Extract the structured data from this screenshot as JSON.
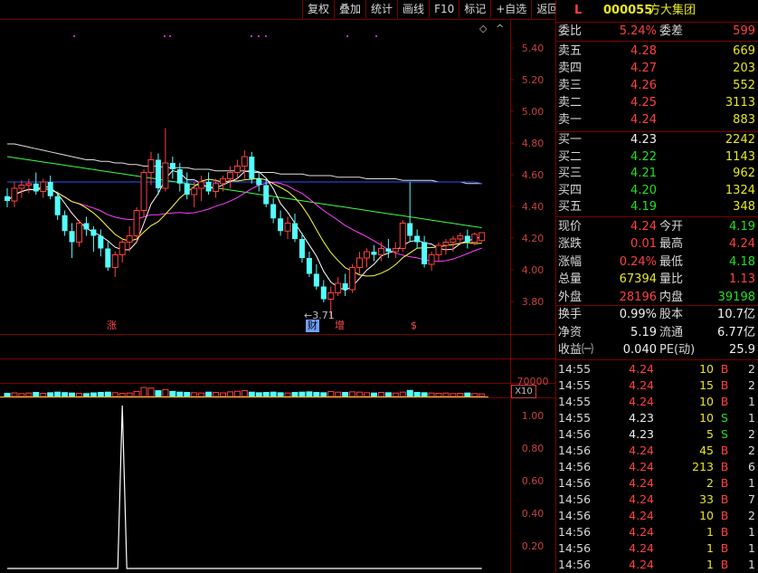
{
  "toolbar": [
    "复权",
    "叠加",
    "统计",
    "画线",
    "F10",
    "标记",
    "+自选",
    "返回"
  ],
  "stock": {
    "flag": "L",
    "code": "000055",
    "name": "方大集团"
  },
  "price_axis": [
    "5.40",
    "5.20",
    "5.00",
    "4.80",
    "4.60",
    "4.40",
    "4.20",
    "4.00",
    "3.80"
  ],
  "volume_axis": {
    "max_label": "70000",
    "scale_label": "X10"
  },
  "indicator_axis": [
    "1.00",
    "0.80",
    "0.60",
    "0.40",
    "0.20"
  ],
  "events": [
    {
      "label": "涨",
      "style": "red"
    },
    {
      "label": "财",
      "style": "blue"
    },
    {
      "label": "增",
      "style": "red"
    },
    {
      "label": "$",
      "style": "red"
    }
  ],
  "min_marker": "←3.71",
  "glyphs": {
    "diamond": "◇",
    "caret": "^"
  },
  "colors": {
    "up": "#ff4040",
    "down": "#54ffff",
    "ma5": "#ffffff",
    "ma10": "#ffff40",
    "ma20": "#ff40ff",
    "ma60": "#40ff40",
    "ma_long": "#e0e0e0",
    "ma_blue": "#3050ff",
    "frame": "#7a0000"
  },
  "order_book": {
    "webi": {
      "label": "委比",
      "value": "5.24%",
      "label2": "委差",
      "value2": "599"
    },
    "asks": [
      {
        "label": "卖五",
        "price": "4.28",
        "vol": "669"
      },
      {
        "label": "卖四",
        "price": "4.27",
        "vol": "203"
      },
      {
        "label": "卖三",
        "price": "4.26",
        "vol": "552"
      },
      {
        "label": "卖二",
        "price": "4.25",
        "vol": "3113"
      },
      {
        "label": "卖一",
        "price": "4.24",
        "vol": "883"
      }
    ],
    "bids": [
      {
        "label": "买一",
        "price": "4.23",
        "vol": "2242"
      },
      {
        "label": "买二",
        "price": "4.22",
        "vol": "1143"
      },
      {
        "label": "买三",
        "price": "4.21",
        "vol": "962"
      },
      {
        "label": "买四",
        "price": "4.20",
        "vol": "1324"
      },
      {
        "label": "买五",
        "price": "4.19",
        "vol": "348"
      }
    ]
  },
  "quote": [
    {
      "l1": "现价",
      "v1": "4.24",
      "l2": "今开",
      "v2": "4.19"
    },
    {
      "l1": "涨跌",
      "v1": "0.01",
      "l2": "最高",
      "v2": "4.24"
    },
    {
      "l1": "涨幅",
      "v1": "0.24%",
      "l2": "最低",
      "v2": "4.18"
    },
    {
      "l1": "总量",
      "v1": "67394",
      "l2": "量比",
      "v2": "1.13"
    },
    {
      "l1": "外盘",
      "v1": "28196",
      "l2": "内盘",
      "v2": "39198"
    }
  ],
  "fundamentals": [
    {
      "l1": "换手",
      "v1": "0.99%",
      "l2": "股本",
      "v2": "10.7亿"
    },
    {
      "l1": "净资",
      "v1": "5.19",
      "l2": "流通",
      "v2": "6.77亿"
    },
    {
      "l1": "收益㈠",
      "v1": "0.040",
      "l2": "PE(动)",
      "v2": "25.9"
    }
  ],
  "ticks": [
    {
      "time": "14:55",
      "price": "4.24",
      "vol": "10",
      "side": "B",
      "n": "2"
    },
    {
      "time": "14:55",
      "price": "4.24",
      "vol": "15",
      "side": "B",
      "n": "2"
    },
    {
      "time": "14:55",
      "price": "4.24",
      "vol": "10",
      "side": "B",
      "n": "1"
    },
    {
      "time": "14:55",
      "price": "4.23",
      "vol": "10",
      "side": "S",
      "n": "1"
    },
    {
      "time": "14:56",
      "price": "4.23",
      "vol": "5",
      "side": "S",
      "n": "2"
    },
    {
      "time": "14:56",
      "price": "4.24",
      "vol": "45",
      "side": "B",
      "n": "2"
    },
    {
      "time": "14:56",
      "price": "4.24",
      "vol": "213",
      "side": "B",
      "n": "6"
    },
    {
      "time": "14:56",
      "price": "4.24",
      "vol": "2",
      "side": "B",
      "n": "1"
    },
    {
      "time": "14:56",
      "price": "4.24",
      "vol": "33",
      "side": "B",
      "n": "7"
    },
    {
      "time": "14:56",
      "price": "4.24",
      "vol": "10",
      "side": "B",
      "n": "2"
    },
    {
      "time": "14:56",
      "price": "4.24",
      "vol": "1",
      "side": "B",
      "n": "1"
    },
    {
      "time": "14:56",
      "price": "4.24",
      "vol": "1",
      "side": "B",
      "n": "1"
    },
    {
      "time": "14:56",
      "price": "4.24",
      "vol": "1",
      "side": "B",
      "n": "1"
    }
  ],
  "chart_data": {
    "type": "candlestick",
    "y_range": [
      3.7,
      5.5
    ],
    "candles": [
      [
        4.47,
        4.52,
        4.4,
        4.44
      ],
      [
        4.44,
        4.56,
        4.4,
        4.52
      ],
      [
        4.52,
        4.57,
        4.46,
        4.54
      ],
      [
        4.54,
        4.58,
        4.49,
        4.55
      ],
      [
        4.55,
        4.62,
        4.48,
        4.5
      ],
      [
        4.5,
        4.58,
        4.46,
        4.56
      ],
      [
        4.56,
        4.6,
        4.45,
        4.47
      ],
      [
        4.47,
        4.5,
        4.32,
        4.35
      ],
      [
        4.35,
        4.38,
        4.22,
        4.25
      ],
      [
        4.25,
        4.3,
        4.08,
        4.18
      ],
      [
        4.18,
        4.32,
        4.15,
        4.3
      ],
      [
        4.3,
        4.34,
        4.22,
        4.26
      ],
      [
        4.26,
        4.28,
        4.12,
        4.22
      ],
      [
        4.22,
        4.26,
        4.09,
        4.14
      ],
      [
        4.14,
        4.18,
        4.0,
        4.02
      ],
      [
        4.02,
        4.12,
        3.96,
        4.1
      ],
      [
        4.1,
        4.2,
        4.05,
        4.18
      ],
      [
        4.18,
        4.28,
        4.12,
        4.22
      ],
      [
        4.22,
        4.4,
        4.18,
        4.38
      ],
      [
        4.38,
        4.64,
        4.34,
        4.62
      ],
      [
        4.62,
        4.75,
        4.54,
        4.7
      ],
      [
        4.7,
        4.74,
        4.48,
        4.52
      ],
      [
        4.52,
        4.9,
        4.5,
        4.68
      ],
      [
        4.68,
        4.72,
        4.58,
        4.64
      ],
      [
        4.64,
        4.68,
        4.5,
        4.55
      ],
      [
        4.55,
        4.62,
        4.45,
        4.48
      ],
      [
        4.48,
        4.56,
        4.4,
        4.52
      ],
      [
        4.52,
        4.6,
        4.44,
        4.56
      ],
      [
        4.56,
        4.62,
        4.48,
        4.5
      ],
      [
        4.5,
        4.58,
        4.46,
        4.55
      ],
      [
        4.55,
        4.6,
        4.5,
        4.58
      ],
      [
        4.58,
        4.66,
        4.52,
        4.62
      ],
      [
        4.62,
        4.7,
        4.58,
        4.66
      ],
      [
        4.66,
        4.76,
        4.58,
        4.72
      ],
      [
        4.72,
        4.75,
        4.55,
        4.58
      ],
      [
        4.58,
        4.62,
        4.5,
        4.54
      ],
      [
        4.54,
        4.58,
        4.4,
        4.42
      ],
      [
        4.42,
        4.46,
        4.3,
        4.33
      ],
      [
        4.33,
        4.38,
        4.22,
        4.25
      ],
      [
        4.25,
        4.34,
        4.2,
        4.3
      ],
      [
        4.3,
        4.36,
        4.18,
        4.2
      ],
      [
        4.2,
        4.24,
        4.05,
        4.08
      ],
      [
        4.08,
        4.12,
        3.96,
        3.98
      ],
      [
        3.98,
        4.04,
        3.88,
        3.9
      ],
      [
        3.9,
        3.94,
        3.8,
        3.82
      ],
      [
        3.82,
        3.9,
        3.71,
        3.86
      ],
      [
        3.86,
        3.96,
        3.84,
        3.92
      ],
      [
        3.92,
        3.98,
        3.84,
        3.88
      ],
      [
        3.88,
        4.04,
        3.86,
        4.02
      ],
      [
        4.02,
        4.12,
        3.98,
        4.08
      ],
      [
        4.08,
        4.14,
        4.02,
        4.12
      ],
      [
        4.12,
        4.16,
        4.06,
        4.1
      ],
      [
        4.1,
        4.18,
        4.06,
        4.14
      ],
      [
        4.14,
        4.2,
        4.08,
        4.12
      ],
      [
        4.12,
        4.18,
        4.08,
        4.14
      ],
      [
        4.14,
        4.32,
        4.12,
        4.3
      ],
      [
        4.3,
        4.56,
        4.18,
        4.22
      ],
      [
        4.22,
        4.26,
        4.14,
        4.18
      ],
      [
        4.18,
        4.22,
        4.02,
        4.04
      ],
      [
        4.04,
        4.12,
        4.0,
        4.1
      ],
      [
        4.1,
        4.18,
        4.06,
        4.16
      ],
      [
        4.16,
        4.2,
        4.1,
        4.18
      ],
      [
        4.18,
        4.22,
        4.12,
        4.2
      ],
      [
        4.2,
        4.24,
        4.16,
        4.22
      ],
      [
        4.22,
        4.26,
        4.14,
        4.18
      ],
      [
        4.18,
        4.24,
        4.16,
        4.23
      ],
      [
        4.19,
        4.24,
        4.18,
        4.24
      ]
    ],
    "volumes": [
      22,
      25,
      20,
      24,
      28,
      22,
      26,
      30,
      27,
      24,
      22,
      20,
      25,
      28,
      30,
      26,
      22,
      24,
      35,
      62,
      58,
      40,
      48,
      35,
      30,
      28,
      26,
      24,
      30,
      28,
      25,
      32,
      36,
      40,
      30,
      26,
      28,
      30,
      26,
      24,
      28,
      30,
      32,
      28,
      26,
      34,
      30,
      28,
      32,
      30,
      26,
      24,
      28,
      26,
      24,
      30,
      42,
      28,
      26,
      24,
      22,
      24,
      20,
      22,
      24,
      20,
      18
    ],
    "ma_long": [
      4.8,
      4.8,
      4.79,
      4.78,
      4.77,
      4.76,
      4.75,
      4.74,
      4.73,
      4.72,
      4.71,
      4.7,
      4.7,
      4.69,
      4.69,
      4.68,
      4.68,
      4.67,
      4.67,
      4.66,
      4.66,
      4.66,
      4.65,
      4.65,
      4.65,
      4.65,
      4.64,
      4.64,
      4.64,
      4.63,
      4.63,
      4.63,
      4.63,
      4.63,
      4.62,
      4.62,
      4.62,
      4.62,
      4.61,
      4.61,
      4.61,
      4.61,
      4.6,
      4.6,
      4.6,
      4.6,
      4.59,
      4.59,
      4.59,
      4.59,
      4.58,
      4.58,
      4.58,
      4.58,
      4.58,
      4.57,
      4.57,
      4.57,
      4.57,
      4.57,
      4.56,
      4.56,
      4.56,
      4.56,
      4.55,
      4.55,
      4.55
    ],
    "ma_blue": [
      4.56,
      4.56,
      4.56,
      4.56,
      4.56,
      4.56,
      4.56,
      4.56,
      4.56,
      4.56,
      4.56,
      4.56,
      4.56,
      4.56,
      4.56,
      4.56,
      4.56,
      4.56,
      4.56,
      4.56,
      4.56,
      4.56,
      4.56,
      4.56,
      4.56,
      4.56,
      4.56,
      4.56,
      4.56,
      4.56,
      4.56,
      4.56,
      4.56,
      4.56,
      4.56,
      4.56,
      4.56,
      4.56,
      4.56,
      4.56,
      4.56,
      4.56,
      4.56,
      4.56,
      4.56,
      4.56,
      4.56,
      4.56,
      4.56,
      4.56,
      4.56,
      4.56,
      4.56,
      4.56,
      4.56,
      4.56,
      4.56,
      4.56,
      4.56,
      4.56,
      4.56,
      4.56,
      4.56,
      4.56,
      4.56,
      4.56,
      4.55
    ]
  },
  "indicator_data": {
    "type": "line",
    "values": [
      0,
      0,
      0,
      0,
      0,
      0,
      0,
      0,
      0,
      0,
      0,
      0,
      0,
      0,
      0,
      0,
      1,
      0,
      0,
      0,
      0,
      0,
      0,
      0,
      0,
      0,
      0,
      0,
      0,
      0,
      0,
      0,
      0,
      0,
      0,
      0,
      0,
      0,
      0,
      0,
      0,
      0,
      0,
      0,
      0,
      0,
      0,
      0,
      0,
      0,
      0,
      0,
      0,
      0,
      0,
      0,
      0,
      0,
      0,
      0,
      0,
      0,
      0,
      0,
      0,
      0,
      0
    ],
    "y_range": [
      0,
      1.1
    ]
  }
}
